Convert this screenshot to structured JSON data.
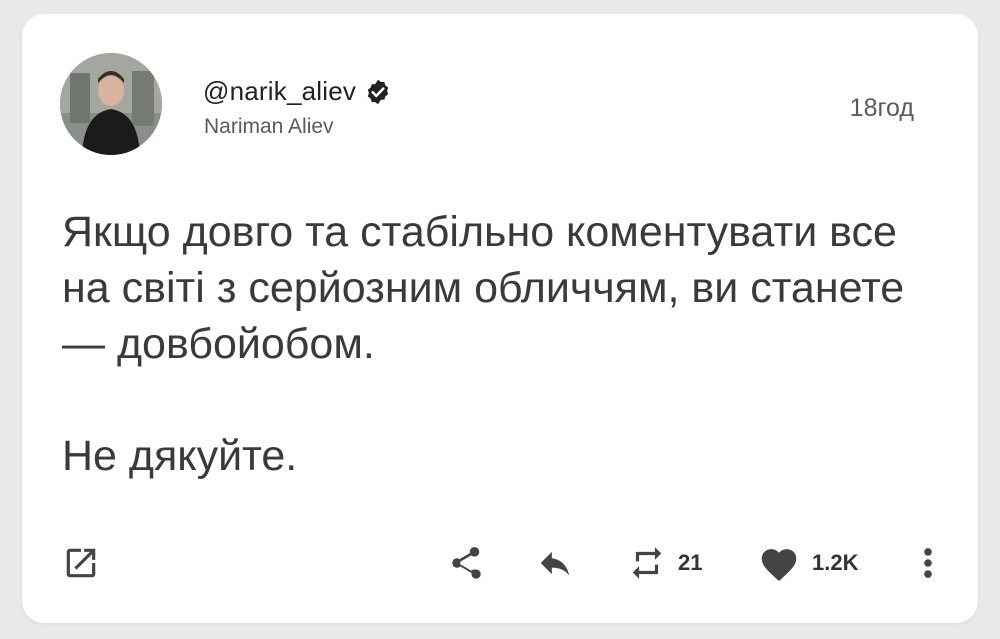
{
  "post": {
    "handle": "@narik_aliev",
    "display_name": "Nariman Aliev",
    "time": "18год",
    "body": [
      "Якщо довго та стабільно коментувати все на світі з серйозним обличчям, ви станете — довбойобом.",
      "Не дякуйте."
    ]
  },
  "actions": {
    "retweet_count": "21",
    "like_count": "1.2K"
  },
  "icons": {
    "open": "open-external-icon",
    "share": "share-icon",
    "reply": "reply-icon",
    "retweet": "retweet-icon",
    "like": "heart-icon",
    "more": "more-vertical-icon",
    "verified": "verified-badge-icon"
  },
  "colors": {
    "text": "#3a3a3a",
    "icon": "#444444",
    "background": "#e9e9e9",
    "card": "#ffffff"
  }
}
